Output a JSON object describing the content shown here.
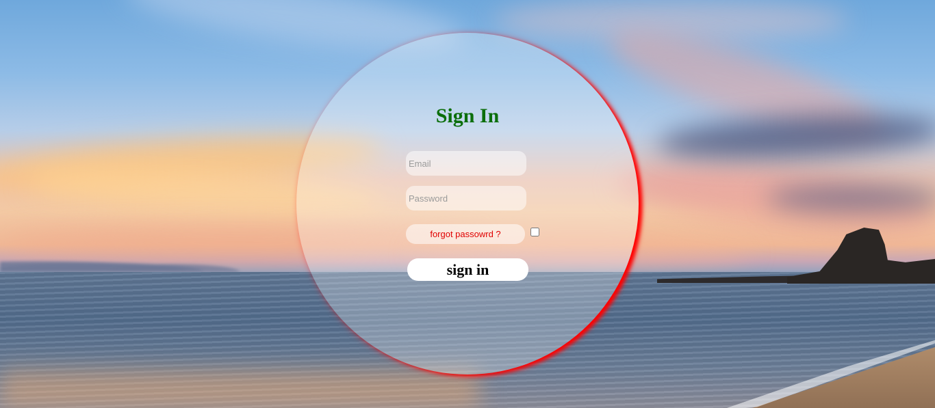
{
  "login": {
    "title": "Sign In",
    "email": {
      "placeholder": "Email",
      "value": ""
    },
    "password": {
      "placeholder": "Password",
      "value": ""
    },
    "forgot_label": "forgot passowrd ?",
    "remember_checked": false,
    "submit_label": "sign in"
  },
  "colors": {
    "title": "#0b6e0b",
    "forgot_text": "#e00000",
    "circle_edge": "#ff0000",
    "button_bg": "#ffffff"
  }
}
